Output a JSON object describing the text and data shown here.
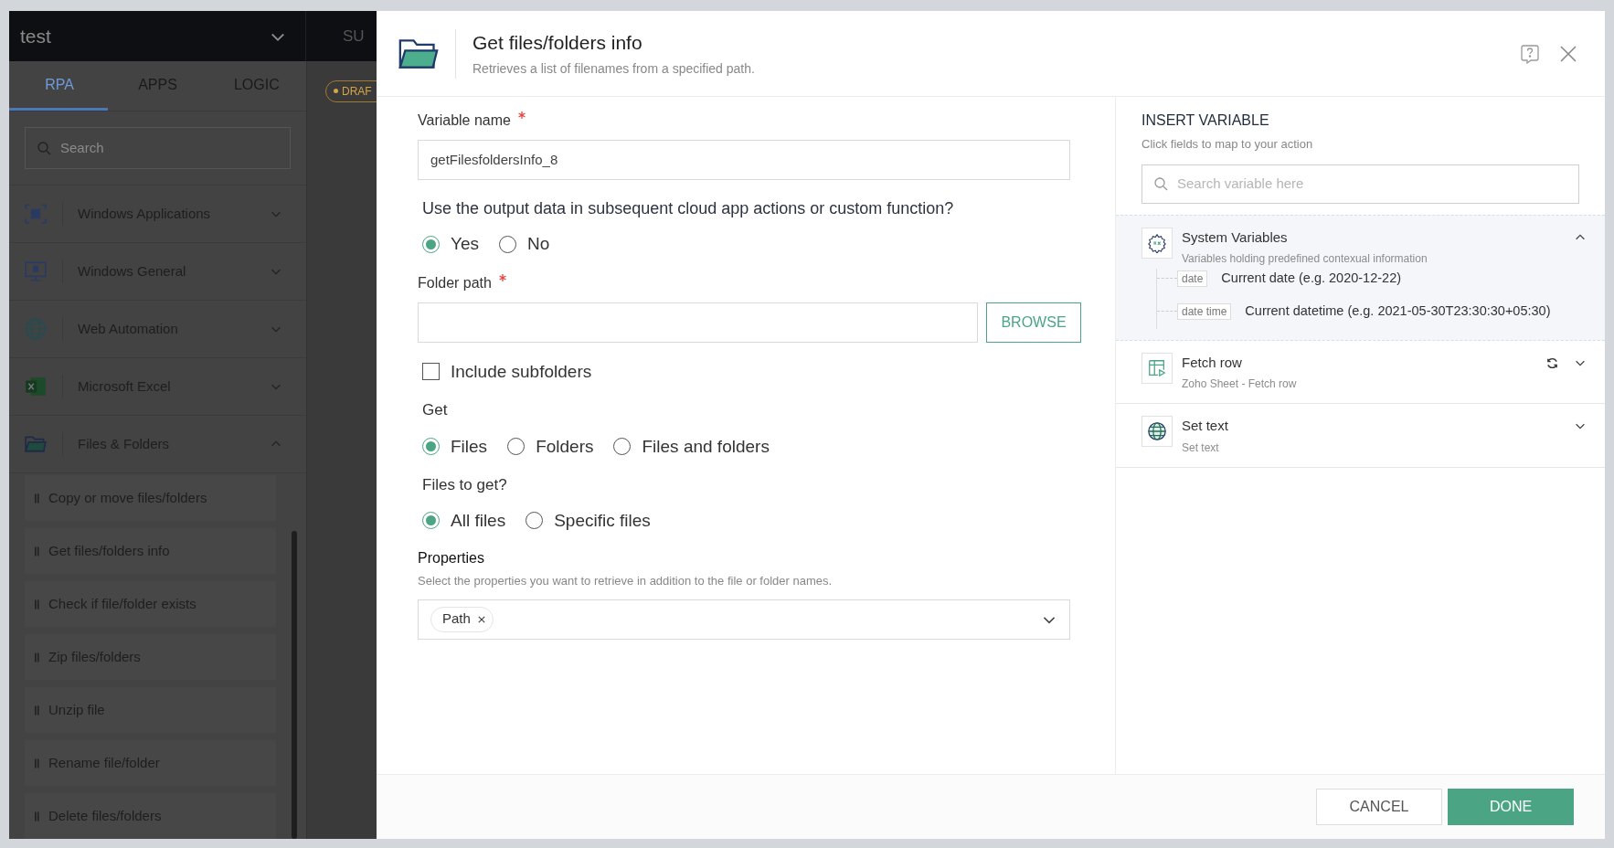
{
  "background_app": {
    "project": "test",
    "top_tab": "SU",
    "tabs": [
      {
        "label": "RPA",
        "selected": true
      },
      {
        "label": "APPS",
        "selected": false
      },
      {
        "label": "LOGIC",
        "selected": false
      }
    ],
    "search": {
      "placeholder": "Search"
    },
    "categories": [
      {
        "label": "Windows Applications",
        "expanded": false
      },
      {
        "label": "Windows General",
        "expanded": false
      },
      {
        "label": "Web Automation",
        "expanded": false
      },
      {
        "label": "Microsoft Excel",
        "expanded": false
      },
      {
        "label": "Files & Folders",
        "expanded": true,
        "children": [
          {
            "label": "Copy or move files/folders"
          },
          {
            "label": "Get files/folders info"
          },
          {
            "label": "Check if file/folder exists"
          },
          {
            "label": "Zip files/folders"
          },
          {
            "label": "Unzip file"
          },
          {
            "label": "Rename file/folder"
          },
          {
            "label": "Delete files/folders"
          }
        ]
      }
    ],
    "badge": "DRAF"
  },
  "dialog": {
    "title": "Get files/folders info",
    "subtitle": "Retrieves a list of filenames from a specified path.",
    "variable_name": {
      "label": "Variable name",
      "required": true,
      "value": "getFilesfoldersInfo_8"
    },
    "use_output": {
      "label": "Use the output data in subsequent cloud app actions or custom function?",
      "options": [
        {
          "label": "Yes",
          "selected": true
        },
        {
          "label": "No",
          "selected": false
        }
      ]
    },
    "folder_path": {
      "label": "Folder path",
      "required": true,
      "button": "BROWSE"
    },
    "include_subfolders": {
      "label": "Include subfolders",
      "checked": false
    },
    "get": {
      "label": "Get",
      "options": [
        {
          "label": "Files",
          "selected": true
        },
        {
          "label": "Folders",
          "selected": false
        },
        {
          "label": "Files and folders",
          "selected": false
        }
      ]
    },
    "files_to_get": {
      "label": "Files to get?",
      "options": [
        {
          "label": "All files",
          "selected": true
        },
        {
          "label": "Specific files",
          "selected": false
        }
      ]
    },
    "properties": {
      "label": "Properties",
      "description": "Select the properties you want to retrieve in addition to the file or folder names.",
      "tags": [
        {
          "label": "Path"
        }
      ]
    },
    "insert_variable": {
      "title": "INSERT VARIABLE",
      "subtitle": "Click fields to map to your action",
      "search": {
        "placeholder": "Search variable here"
      },
      "groups": [
        {
          "title": "System Variables",
          "subtitle": "Variables holding predefined contexual information",
          "expanded": true,
          "refresh": false,
          "variables": [
            {
              "tag": "date",
              "description": "Current date (e.g. 2020-12-22)"
            },
            {
              "tag": "date time",
              "description": "Current datetime (e.g. 2021-05-30T23:30:30+05:30)"
            }
          ]
        },
        {
          "title": "Fetch row",
          "subtitle": "Zoho Sheet - Fetch row",
          "expanded": false,
          "refresh": true
        },
        {
          "title": "Set text",
          "subtitle": "Set text",
          "expanded": false,
          "refresh": false
        }
      ]
    },
    "buttons": [
      {
        "label": "CANCEL",
        "kind": "secondary"
      },
      {
        "label": "DONE",
        "kind": "primary"
      }
    ]
  }
}
